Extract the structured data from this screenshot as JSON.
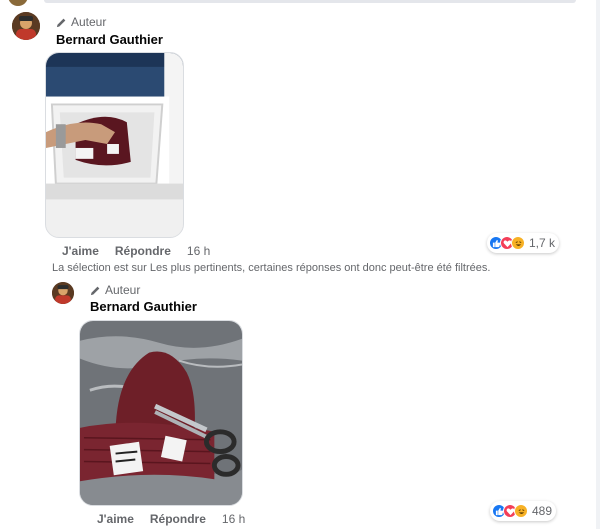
{
  "comments": [
    {
      "author_badge": "Auteur",
      "author_name": "Bernard Gauthier",
      "image": "photo of a hand placing a maroon knit beanie into a white storage bin",
      "actions": {
        "like": "J'aime",
        "reply": "Répondre",
        "time": "16 h"
      },
      "reactions": {
        "icons": [
          "like-icon",
          "love-icon",
          "haha-icon"
        ],
        "count": "1,7 k"
      }
    },
    {
      "author_badge": "Auteur",
      "author_name": "Bernard Gauthier",
      "image": "photo of a maroon knit beanie with a MALBO patch next to scissors on a marble surface",
      "actions": {
        "like": "J'aime",
        "reply": "Répondre",
        "time": "16 h"
      },
      "reactions": {
        "icons": [
          "like-icon",
          "love-icon",
          "haha-icon"
        ],
        "count": "489"
      }
    }
  ],
  "filter_note": "La sélection est sur Les plus pertinents, certaines réponses ont donc peut-être été filtrées.",
  "colors": {
    "like": "#1877f2",
    "love": "#f33e58",
    "haha": "#f7b125",
    "secondary_text": "#65676b",
    "beanie": "#6e1f28"
  }
}
